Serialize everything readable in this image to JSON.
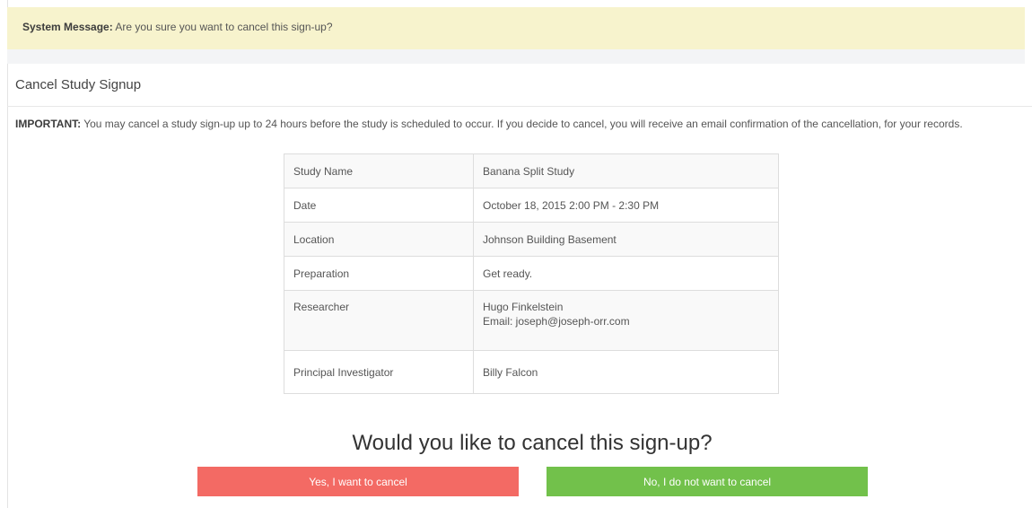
{
  "system_message": {
    "label": "System Message:",
    "text": " Are you sure you want to cancel this sign-up?"
  },
  "panel": {
    "title": "Cancel Study Signup",
    "important_label": "IMPORTANT:",
    "important_text": " You may cancel a study sign-up up to 24 hours before the study is scheduled to occur. If you decide to cancel, you will receive an email confirmation of the cancellation, for your records."
  },
  "details": {
    "rows": [
      {
        "label": "Study Name",
        "value": "Banana Split Study"
      },
      {
        "label": "Date",
        "value": "October 18, 2015 2:00 PM - 2:30 PM"
      },
      {
        "label": "Location",
        "value": "Johnson Building Basement"
      },
      {
        "label": "Preparation",
        "value": "Get ready."
      },
      {
        "label": "Researcher",
        "value": "Hugo Finkelstein",
        "email": "Email: joseph@joseph-orr.com"
      },
      {
        "label": "Principal Investigator",
        "value": "Billy Falcon"
      }
    ]
  },
  "confirm": {
    "question": "Would you like to cancel this sign-up?",
    "yes_label": "Yes, I want to cancel",
    "no_label": "No, I do not want to cancel"
  },
  "colors": {
    "system_message_bg": "#f7f3cd",
    "yes_button": "#f36a64",
    "no_button": "#72c14b"
  }
}
